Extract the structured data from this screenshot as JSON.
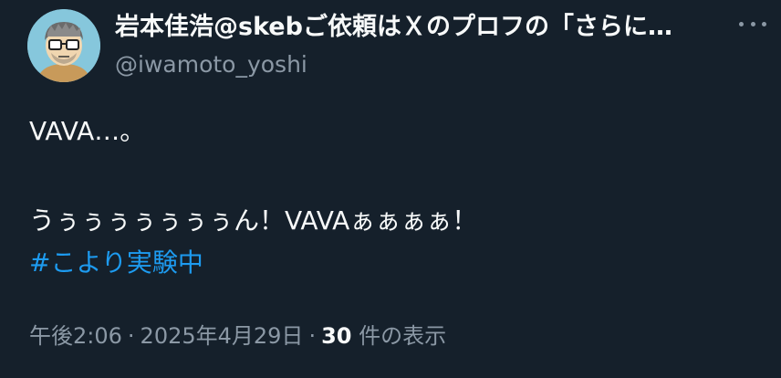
{
  "tweet": {
    "display_name": "岩本佳浩@skebご依頼はＸのプロフの「さらに…",
    "handle": "@iwamoto_yoshi",
    "more_icon": "more-horizontal-icon",
    "text_line1": "VAVA…。",
    "text_line2": "うぅぅぅぅぅぅぅん！VAVAぁぁぁぁ！",
    "hashtag": "#こより実験中",
    "time": "午後2:06",
    "separator": "·",
    "date": "2025年4月29日",
    "view_count": "30",
    "view_label": " 件の表示"
  },
  "colors": {
    "background": "#15202b",
    "text": "#f7f9f9",
    "secondary": "#8b98a5",
    "link": "#1d9bf0"
  }
}
